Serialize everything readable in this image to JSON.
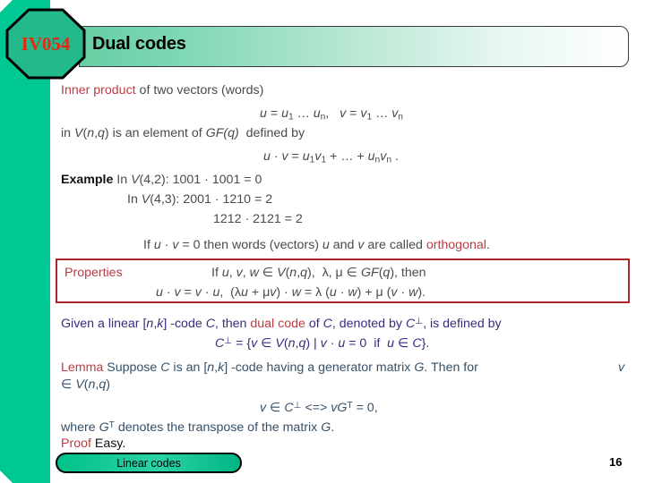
{
  "slide": {
    "badge_label": "IV054",
    "title": "Dual codes",
    "page_number": "16",
    "footer_label": "Linear codes",
    "colors": {
      "strip_green": "#00c895",
      "badge_green": "#22b98c",
      "badge_text_red": "#e02b12",
      "accent_red": "#bf3a43",
      "box_border_red": "#a4282a",
      "indigo_text": "#3b2a7d",
      "slate_text": "#355069",
      "body_gray": "#4a4a4a"
    }
  },
  "body": {
    "inner_product": {
      "term": "Inner product",
      "rest": " of two vectors (words)",
      "line_u_v_prefix_u": "u",
      "line_u_v": " = u1 … un,   v = v1 … vn",
      "in_line": "in V(n,q) is an element of GF(q)  defined by",
      "dot_def": "u · v = u1 v1 + … + un vn ."
    },
    "example": {
      "label": "Example",
      "line1": "In V(4,2): 1001 · 1001 = 0",
      "line2": "In V(4,3): 2001 · 1210 = 2",
      "line3": "1212 · 2121 = 2"
    },
    "orthogonal_line": {
      "prefix": "If u · v = 0 then words (vectors) u and v are called ",
      "term": "orthogonal",
      "period": "."
    },
    "properties": {
      "label": "Properties",
      "line1": "If u, v, w ∈ V(n,q),  λ, μ ∈ GF(q), then",
      "line2": "u · v = v · u,  (λu + μv) · w = λ (u · w) + μ (v · w)."
    },
    "dual_code": {
      "line1_a": "Given a linear [n,k] -code C, then ",
      "line1_term": "dual code",
      "line1_b": " of C, denoted by C⊥, is defined by",
      "line2": "C⊥ = {v ∈ V(n,q) | v · u = 0  if  u ∈ C}."
    },
    "lemma": {
      "label": "Lemma",
      "line1": " Suppose C is an [n,k] -code having a generator matrix G. Then for",
      "line1_tail": "v",
      "line2": "∈ V(n,q)",
      "line3": "v ∈ C⊥ <=> vGT = 0,",
      "line4": "where GT denotes the transpose of the matrix G."
    },
    "proof": {
      "label": "Proof",
      "text": " Easy."
    }
  }
}
